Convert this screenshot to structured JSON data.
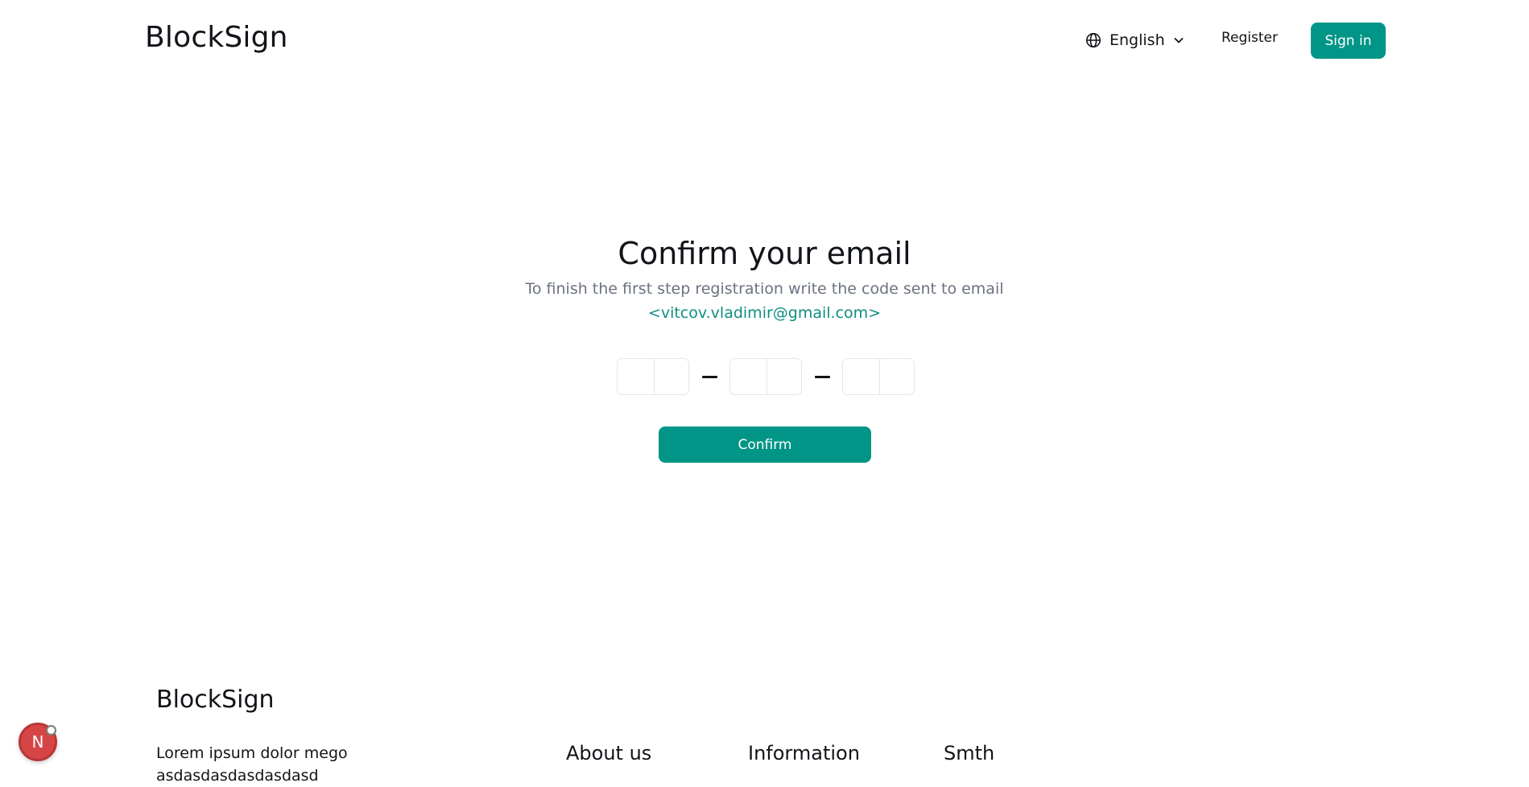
{
  "header": {
    "logo": "BlockSign",
    "language": "English",
    "register_label": "Register",
    "signin_label": "Sign in"
  },
  "main": {
    "title": "Confirm your email",
    "subtitle": "To finish the first step registration write the code sent to email",
    "email": "<vitcov.vladimir@gmail.com>",
    "code_values": [
      "",
      "",
      "",
      "",
      "",
      ""
    ],
    "confirm_label": "Confirm"
  },
  "footer": {
    "logo": "BlockSign",
    "text": "Lorem ipsum dolor mego asdasdasdasdasdasd",
    "columns": [
      "About us",
      "Information",
      "Smth"
    ]
  },
  "badge": {
    "letter": "N"
  },
  "colors": {
    "accent": "#019587",
    "email_text": "#0f8f82",
    "muted_text": "#6b7280",
    "badge": "#d64545"
  },
  "icons": {
    "language": "globe-icon",
    "dropdown": "chevron-down-icon"
  }
}
